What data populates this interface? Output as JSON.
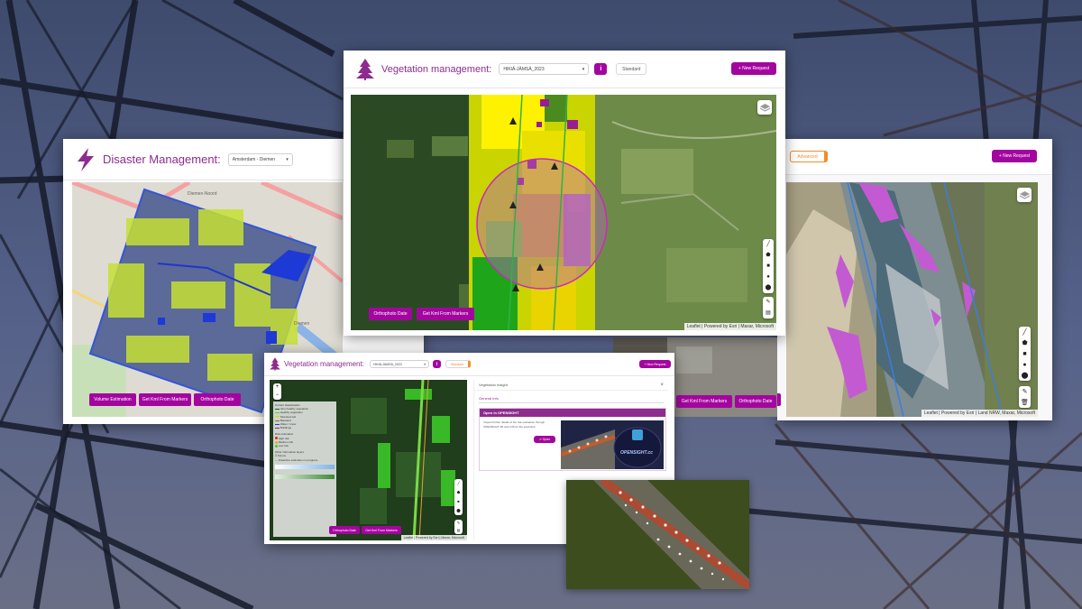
{
  "colors": {
    "brand": "#a3069f",
    "title": "#8e2b8e",
    "advanced": "#f28c28"
  },
  "disaster": {
    "title": "Disaster Management:",
    "icon": "lightning-icon",
    "location_select": "Amsterdam - Diemen",
    "map_labels": {
      "a": "Diemen-Noord",
      "b": "Diemen"
    },
    "buttons": [
      "Volume Estimation",
      "Get Kml From Markers",
      "Orthophoto Date"
    ]
  },
  "vegetation_main": {
    "title": "Vegetation management:",
    "icon": "tree-icon",
    "project_select": "HIKIÄ-JÄMSÄ_2023",
    "info_label": "i",
    "mode_toggle": "Standard",
    "new_request": "+ New Request",
    "buttons": [
      "Orthophoto Date",
      "Get Kml From Markers"
    ],
    "attribution": "Leaflet | Powered by Esri | Maxar, Microsoft"
  },
  "right_panel": {
    "mode_toggle": "Advanced",
    "new_request": "+ New Request",
    "buttons": [
      "Get Kml From Markers",
      "Orthophoto Date"
    ],
    "attribution": "Leaflet | Powered by Esri | Land NRW, Maxar, Microsoft"
  },
  "vegetation_small": {
    "title": "Vegetation management:",
    "icon": "tree-icon",
    "project_select": "HIKIÄ-JÄMSÄ_2023",
    "info_label": "i",
    "mode_toggle": "Standard",
    "new_request": "+ New Request",
    "legend": {
      "section1_title": "Current classification",
      "classes": [
        "Very healthy vegetation",
        "Healthy vegetation",
        "Stressed soil",
        "Bareland",
        "Water / snow",
        "Buildings"
      ],
      "section2_title": "Risk estimation",
      "risks": [
        "High risk",
        "Medium risk",
        "Low risk"
      ],
      "section3_title": "Other information layers",
      "others": [
        "Pylons",
        "Powerline estimation in progress"
      ]
    },
    "buttons": [
      "Orthophoto Date",
      "Get Kml From Markers"
    ],
    "attribution": "Leaflet | Powered by Esri | Maxar, Microsoft",
    "insight": {
      "panel_title": "Vegetation Insight",
      "close": "×",
      "section": "General info",
      "card_title": "Open in OPENSIGHT",
      "card_text": "Inspect further details of the risk evaluation through OPENSIGHT 3D web GIS for the powerline",
      "open_button": "Open",
      "logo_text": "OPENSIGHT.cc"
    }
  }
}
